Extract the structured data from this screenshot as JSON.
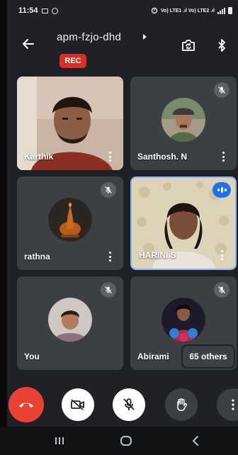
{
  "status_bar": {
    "time": "11:54",
    "signal_text": "Vo) LTE1 .ıl Vo) LTE2 .ıl"
  },
  "header": {
    "meeting_code": "apm-fzjo-dhd",
    "rec_label": "REC"
  },
  "participants": [
    {
      "name": "Karthik",
      "video_on": true,
      "muted": false
    },
    {
      "name": "Santhosh. N",
      "video_on": false,
      "muted": true
    },
    {
      "name": "rathna",
      "video_on": false,
      "muted": true
    },
    {
      "name": "HARINI.S",
      "video_on": true,
      "speaking": true
    },
    {
      "name": "You",
      "video_on": false,
      "muted": true
    },
    {
      "name": "Abirami",
      "video_on": false,
      "muted": true
    }
  ],
  "others_label": "65 others",
  "colors": {
    "background": "#202124",
    "tile": "#3c4043",
    "end_call": "#ea4335",
    "rec": "#d93025",
    "active_speaker": "#1a73e8"
  },
  "icons": {
    "back": "arrow-left-icon",
    "switch_camera": "switch-camera-icon",
    "audio_output": "bluetooth-icon",
    "end_call": "phone-hangup-icon",
    "camera": "camera-off-icon",
    "mic": "mic-off-icon",
    "raise_hand": "hand-icon",
    "more": "more-vertical-icon"
  }
}
